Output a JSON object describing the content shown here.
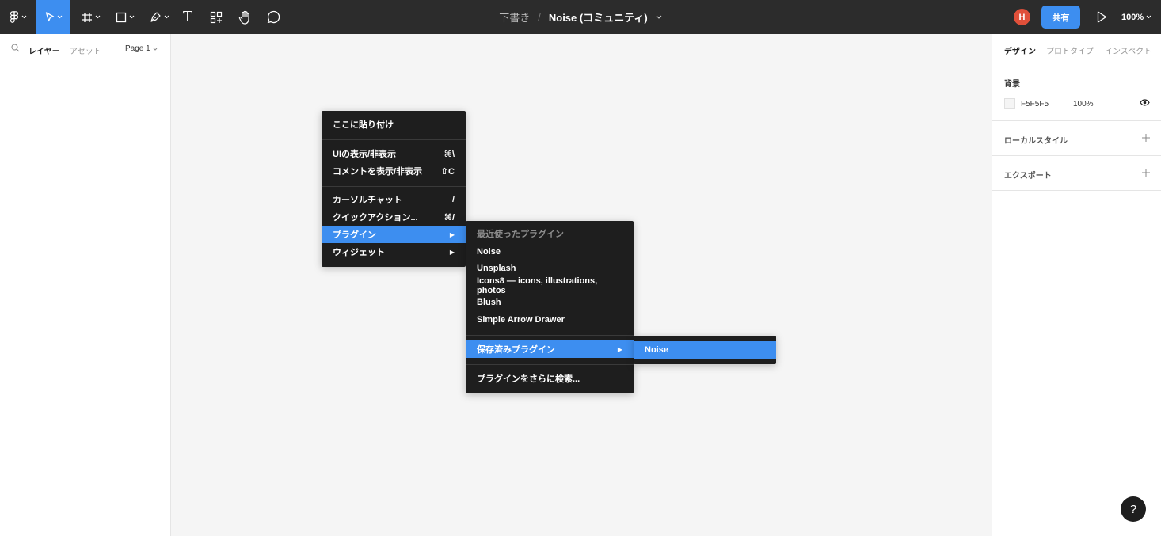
{
  "toolbar": {
    "draft_label": "下書き",
    "separator": "/",
    "file_name": "Noise (コミュニティ)",
    "avatar_initial": "H",
    "share_label": "共有",
    "zoom": "100%",
    "text_tool_glyph": "T"
  },
  "left_panel": {
    "tab_layers": "レイヤー",
    "tab_assets": "アセット",
    "page_selector": "Page 1"
  },
  "right_panel": {
    "tab_design": "デザイン",
    "tab_prototype": "プロトタイプ",
    "tab_inspect": "インスペクト",
    "background": {
      "title": "背景",
      "hex": "F5F5F5",
      "opacity": "100%"
    },
    "local_styles": "ローカルスタイル",
    "export": "エクスポート"
  },
  "context_menu": {
    "paste_here": "ここに貼り付け",
    "toggle_ui": "UIの表示/非表示",
    "toggle_ui_shortcut": "⌘\\",
    "toggle_comments": "コメントを表示/非表示",
    "toggle_comments_shortcut": "⇧C",
    "cursor_chat": "カーソルチャット",
    "cursor_chat_shortcut": "/",
    "quick_actions": "クイックアクション...",
    "quick_actions_shortcut": "⌘/",
    "plugins": "プラグイン",
    "widgets": "ウィジェット"
  },
  "plugins_menu": {
    "recent_header": "最近使ったプラグイン",
    "items": [
      "Noise",
      "Unsplash",
      "Icons8 — icons, illustrations, photos",
      "Blush",
      "Simple Arrow Drawer"
    ],
    "saved_plugins": "保存済みプラグイン",
    "find_more": "プラグインをさらに検索..."
  },
  "saved_menu": {
    "items": [
      "Noise"
    ]
  },
  "help_label": "?",
  "colors": {
    "toolbar": "#2c2c2c",
    "accent": "#3d8ef0",
    "menu": "#1e1e1e",
    "canvas": "#f5f5f5",
    "avatar": "#e0503a"
  }
}
